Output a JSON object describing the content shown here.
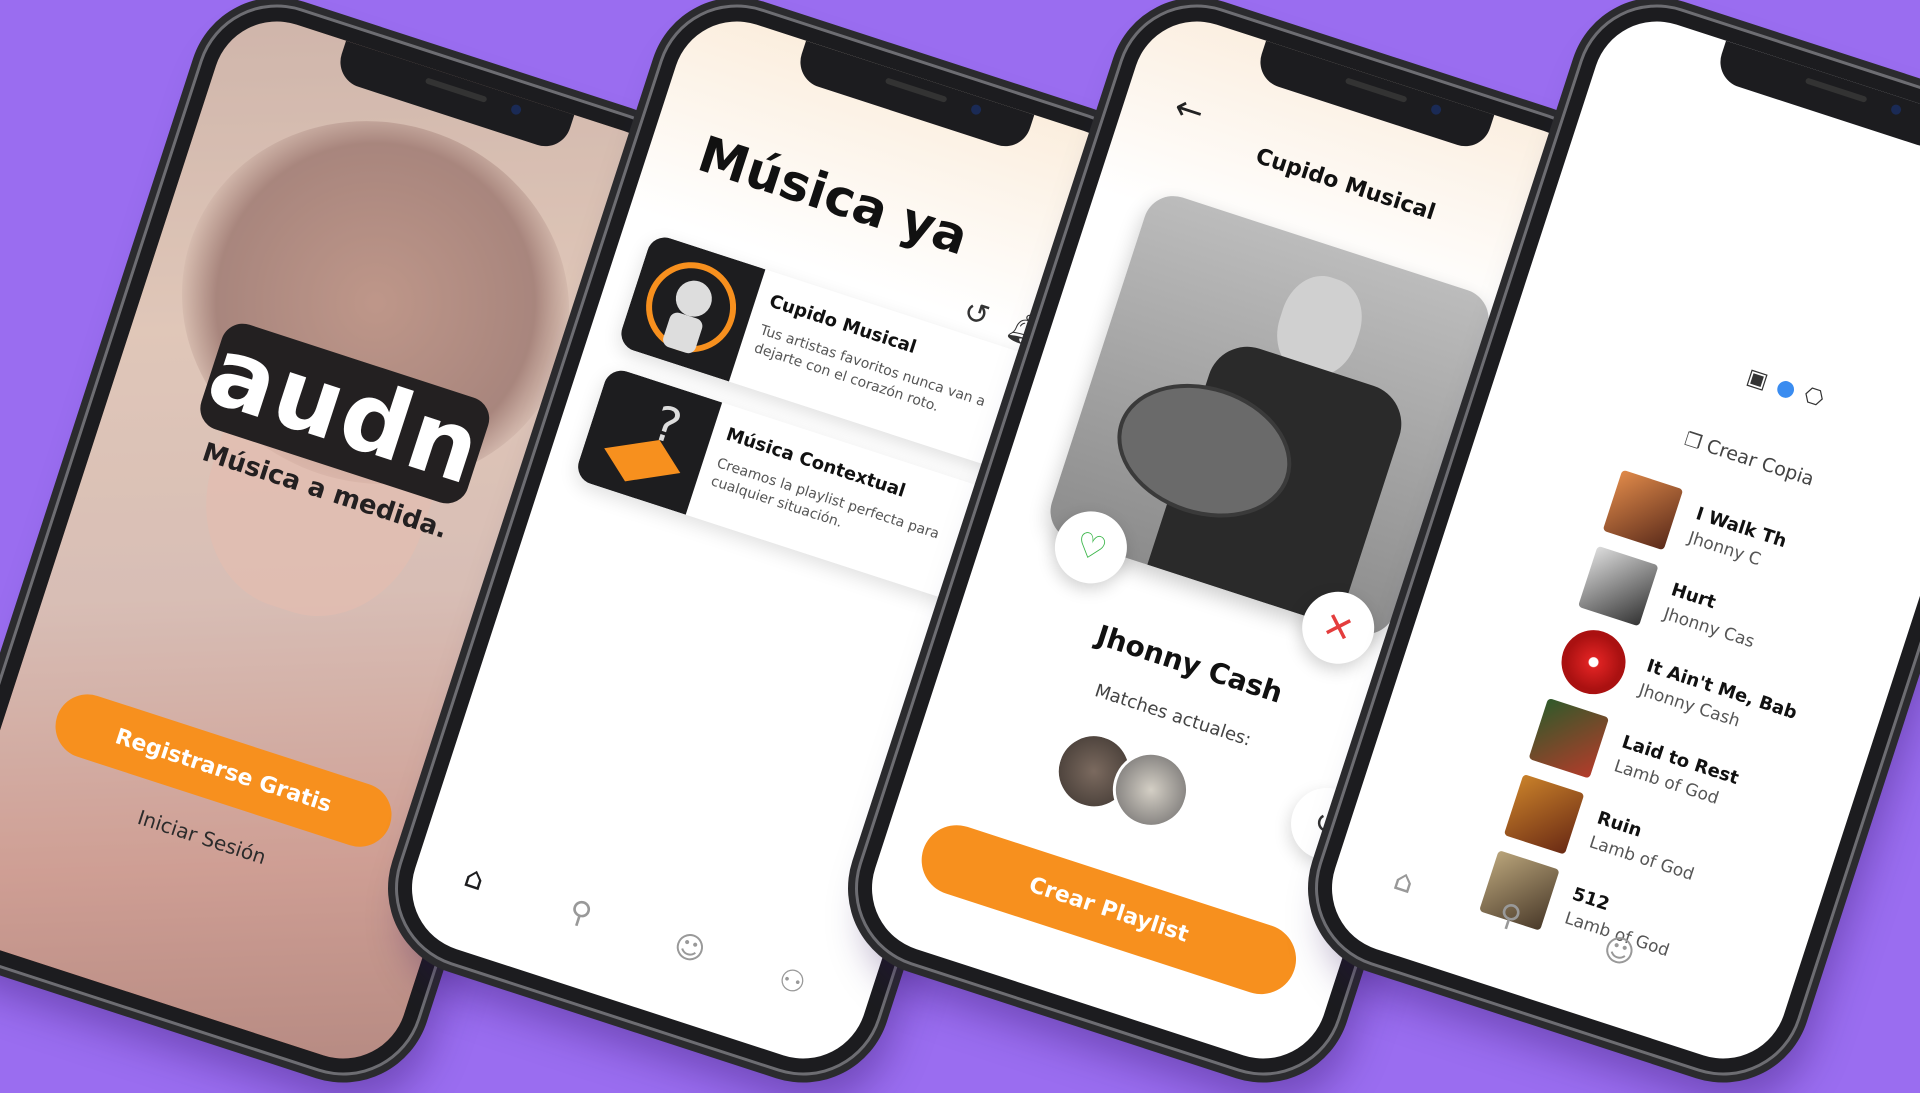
{
  "onboarding": {
    "logo": "audn",
    "tagline": "Música a medida.",
    "register_label": "Registrarse Gratis",
    "login_label": "Iniciar Sesión"
  },
  "home": {
    "title": "Música ya",
    "cards": [
      {
        "title": "Cupido Musical",
        "description": "Tus artistas favoritos nunca van a dejarte con el corazón roto."
      },
      {
        "title": "Música Contextual",
        "description": "Creamos la playlist perfecta para cualquier situación."
      }
    ],
    "icons": [
      "history-icon",
      "bell-icon",
      "home-icon",
      "search-icon",
      "profile-icon",
      "friends-icon"
    ]
  },
  "cupido": {
    "title": "Cupido Musical",
    "artist": "Jhonny Cash",
    "matches_label": "Matches actuales:",
    "create_label": "Crear Playlist"
  },
  "playlist": {
    "copy_label": "Crear Copia",
    "tracks": [
      {
        "name": "I Walk Th",
        "artist": "Jhonny C"
      },
      {
        "name": "Hurt",
        "artist": "Jhonny Cas"
      },
      {
        "name": "It Ain't Me, Bab",
        "artist": "Jhonny Cash"
      },
      {
        "name": "Laid to Rest",
        "artist": "Lamb of God"
      },
      {
        "name": "Ruin",
        "artist": "Lamb of God"
      },
      {
        "name": "512",
        "artist": "Lamb of God"
      }
    ]
  },
  "colors": {
    "background": "#9a6df0",
    "accent": "#f7901e",
    "like": "#3bb64a",
    "dislike": "#e43d3d"
  }
}
